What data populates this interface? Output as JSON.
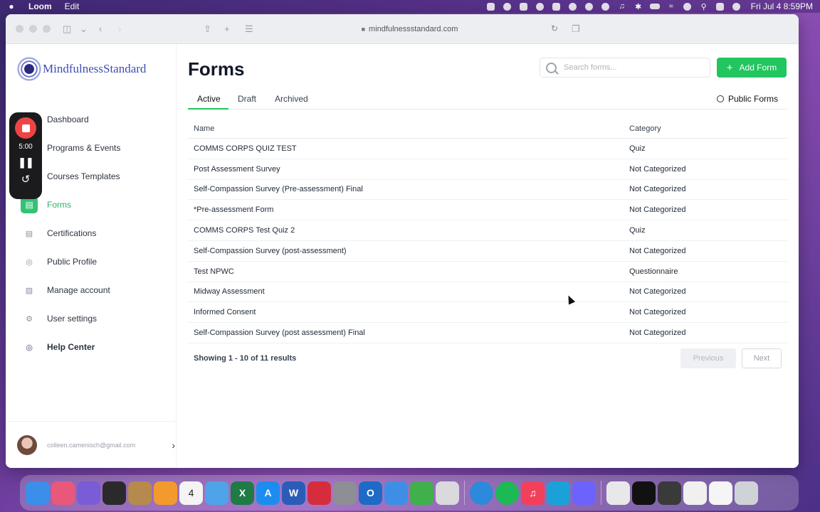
{
  "menubar": {
    "app_name": "Loom",
    "menu_edit": "Edit",
    "datetime": "Fri Jul 4  8:59PM"
  },
  "browser": {
    "url": "mindfulnessstandard.com"
  },
  "brand": {
    "logo_text": "MindfulnessStandard",
    "accent": "#22c55e"
  },
  "recorder": {
    "time": "5:00"
  },
  "sidebar": {
    "items": [
      {
        "label": "Dashboard",
        "icon": "dashboard-icon"
      },
      {
        "label": "Programs & Events",
        "icon": "calendar-icon"
      },
      {
        "label": "Courses Templates",
        "icon": "book-icon"
      },
      {
        "label": "Forms",
        "icon": "forms-icon",
        "active": true
      },
      {
        "label": "Certifications",
        "icon": "certificate-icon"
      },
      {
        "label": "Public Profile",
        "icon": "profile-icon"
      },
      {
        "label": "Manage account",
        "icon": "building-icon"
      },
      {
        "label": "User settings",
        "icon": "gear-icon"
      },
      {
        "label": "Help Center",
        "icon": "help-icon"
      }
    ],
    "user_email": "colleen.camenisch@gmail.com"
  },
  "main": {
    "title": "Forms",
    "search_placeholder": "Search forms...",
    "add_button": "Add Form",
    "tabs": [
      "Active",
      "Draft",
      "Archived"
    ],
    "public_forms": "Public Forms",
    "columns": {
      "name": "Name",
      "category": "Category"
    },
    "rows": [
      {
        "name": "COMMS CORPS QUIZ TEST",
        "category": "Quiz"
      },
      {
        "name": "Post Assessment Survey",
        "category": "Not Categorized"
      },
      {
        "name": "Self-Compassion Survey (Pre-assessment) Final",
        "category": "Not Categorized"
      },
      {
        "name": "*Pre-assessment Form",
        "category": "Not Categorized"
      },
      {
        "name": "COMMS CORPS Test Quiz 2",
        "category": "Quiz"
      },
      {
        "name": "Self-Compassion Survey (post-assessment)",
        "category": "Not Categorized"
      },
      {
        "name": "Test NPWC",
        "category": "Questionnaire"
      },
      {
        "name": "Midway Assessment",
        "category": "Not Categorized"
      },
      {
        "name": "Informed Consent",
        "category": "Not Categorized"
      },
      {
        "name": "Self-Compassion Survey (post assessment) Final",
        "category": "Not Categorized"
      }
    ],
    "results_text": "Showing 1 - 10 of 11 results",
    "prev_label": "Previous",
    "next_label": "Next"
  },
  "dock": {
    "calendar_day": "4"
  }
}
